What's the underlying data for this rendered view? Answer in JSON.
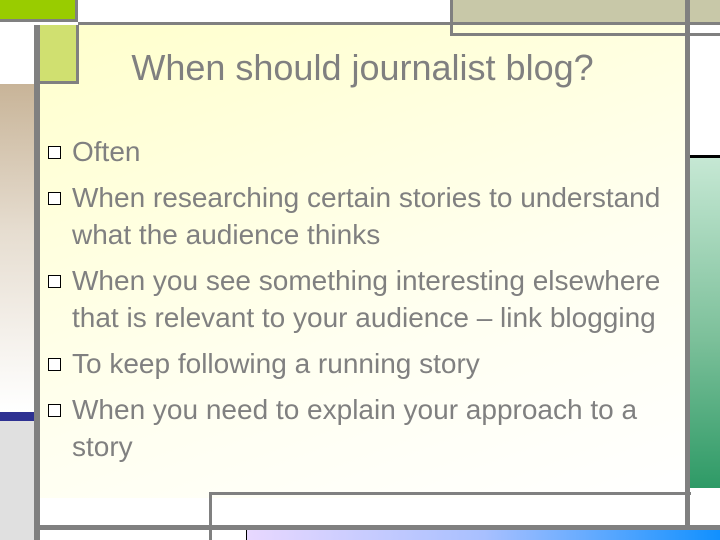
{
  "slide": {
    "title": "When should journalist blog?",
    "bullets": [
      {
        "text": "Often"
      },
      {
        "text": "When researching certain stories to understand what the audience thinks"
      },
      {
        "text": "When you see something interesting elsewhere that is relevant to your audience – link blogging"
      },
      {
        "text": "To keep following a running story"
      },
      {
        "text": "When you need to explain your approach to a story"
      }
    ],
    "bullet_icon": "hollow-square-icon"
  },
  "theme": {
    "title_color": "#808080",
    "text_color": "#808080",
    "accent_green": "#99cc00",
    "accent_navy": "#2e3192",
    "background": "#ffffcc"
  }
}
